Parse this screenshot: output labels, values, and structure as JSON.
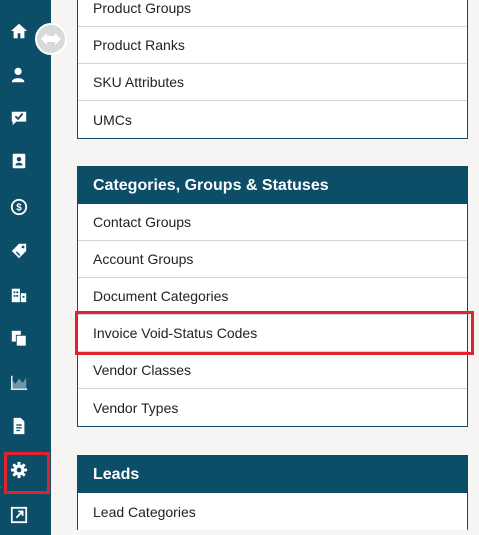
{
  "sidebar": {
    "items": [
      {
        "icon": "home-icon"
      },
      {
        "icon": "contacts-icon"
      },
      {
        "icon": "tasks-icon"
      },
      {
        "icon": "contact-card-icon"
      },
      {
        "icon": "dollar-icon"
      },
      {
        "icon": "tag-icon"
      },
      {
        "icon": "buildings-icon"
      },
      {
        "icon": "documents-icon"
      },
      {
        "icon": "chart-icon"
      },
      {
        "icon": "report-icon"
      },
      {
        "icon": "gear-icon",
        "active": true
      },
      {
        "icon": "external-link-icon"
      }
    ],
    "collapse_icon": "double-arrow-icon"
  },
  "products_panel": {
    "items": [
      "Product Groups",
      "Product Ranks",
      "SKU Attributes",
      "UMCs"
    ]
  },
  "categories_panel": {
    "title": "Categories, Groups & Statuses",
    "items": [
      "Contact Groups",
      "Account Groups",
      "Document Categories",
      "Invoice Void-Status Codes",
      "Vendor Classes",
      "Vendor Types"
    ],
    "highlighted": "Invoice Void-Status Codes"
  },
  "leads_panel": {
    "title": "Leads",
    "items": [
      "Lead Categories"
    ]
  },
  "colors": {
    "sidebar": "#0c4d68",
    "header": "#0c4d68",
    "highlight": "#e0242f",
    "background": "#f6f5f3"
  }
}
